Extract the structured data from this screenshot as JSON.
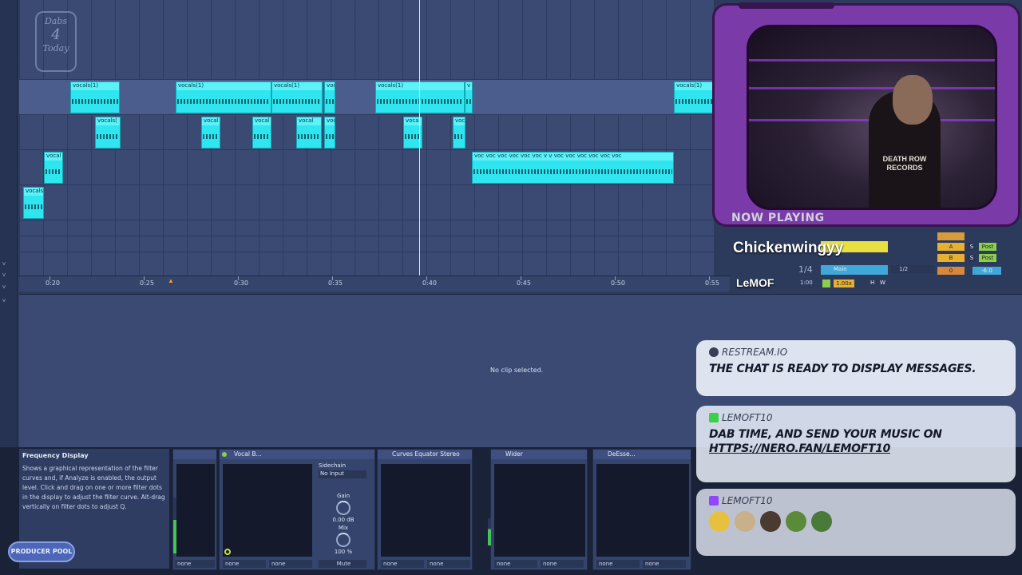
{
  "logo": {
    "line1": "Dabs",
    "line2": "4",
    "line3": "Today"
  },
  "arrangement": {
    "clips": [
      {
        "label": "vocals(1)"
      },
      {
        "label": "vocals(1)"
      },
      {
        "label": "vocals(1)"
      },
      {
        "label": "voc"
      },
      {
        "label": "vocals(1)"
      },
      {
        "label": "v"
      },
      {
        "label": "vocals(1)"
      },
      {
        "label": "vocals("
      },
      {
        "label": "vocal"
      },
      {
        "label": "vocal"
      },
      {
        "label": "vocal"
      },
      {
        "label": "voc"
      },
      {
        "label": "vocal"
      },
      {
        "label": "vocal"
      },
      {
        "label": "vocal"
      },
      {
        "label": "vocals"
      },
      {
        "label": "voc voc voc voc voc voc v v voc voc voc voc voc voc"
      }
    ],
    "ruler_ticks": [
      "0:20",
      "0:25",
      "0:30",
      "0:35",
      "0:40",
      "0:45",
      "0:50",
      "0:55"
    ]
  },
  "clip_view": {
    "message": "No clip selected."
  },
  "info_panel": {
    "title": "Frequency Display",
    "description": "Shows a graphical representation of the filter curves and, if Analyze is enabled, the output level. Click and drag on one or more filter dots in the display to adjust the filter curve. Alt-drag vertically on filter dots to adjust Q."
  },
  "devices": {
    "vocal_b": {
      "title": "Vocal B..."
    },
    "sidechain": {
      "label": "Sidechain",
      "input": "No Input",
      "gain_label": "Gain",
      "gain_value": "0.00 dB",
      "mix_label": "Mix",
      "mix_value": "100 %",
      "mute": "Mute"
    },
    "curves": {
      "title": "Curves Equator Stereo"
    },
    "wider": {
      "title": "Wider"
    },
    "deesser": {
      "title": "DeEsse..."
    },
    "footers": [
      "none",
      "none",
      "none",
      "none",
      "none",
      "none",
      "none",
      "none",
      "none"
    ]
  },
  "stream": {
    "now_playing_label": "NOW PLAYING",
    "track": "Chickenwingyy",
    "artist": "LeMOF",
    "shirt_text": "DEATH ROW RECORDS"
  },
  "mixer": {
    "position": "1/4",
    "time": "1:00",
    "tempo": "1.00x",
    "main_label": "Main",
    "ratio": "1/2",
    "a": "A",
    "b": "B",
    "s": "S",
    "post": "Post",
    "zero": "0",
    "level": "-6.0",
    "h": "H",
    "w": "W"
  },
  "chat": [
    {
      "source": "RESTREAM.IO",
      "text": "THE CHAT IS READY TO DISPLAY MESSAGES."
    },
    {
      "source": "LEMOFT10",
      "text": "DAB TIME, AND SEND YOUR MUSIC ON",
      "link": "HTTPS://NERO.FAN/LEMOFT10"
    },
    {
      "source": "LEMOFT10"
    }
  ],
  "producer_pool": "PRODUCER POOL",
  "colors": {
    "clip": "#2fe6f0",
    "frame": "#7a3aa8",
    "accent_orange": "#ff9a2a",
    "green": "#46c35a"
  }
}
